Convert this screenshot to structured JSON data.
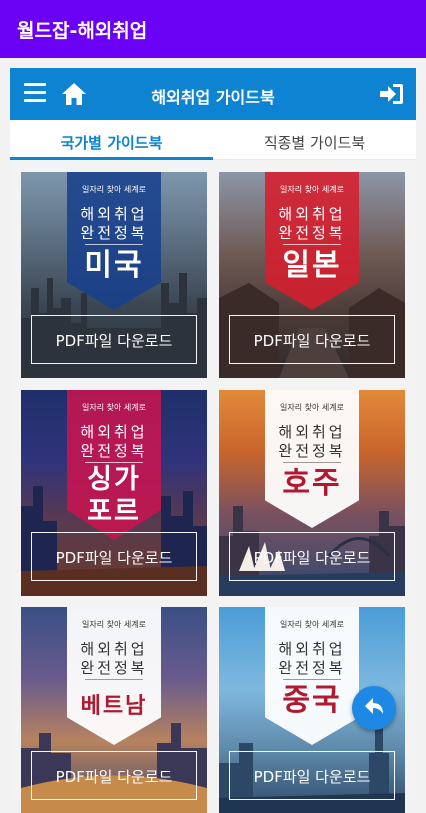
{
  "app": {
    "title": "월드잡-해외취업"
  },
  "topbar": {
    "title": "해외취업 가이드북",
    "icons": [
      "menu-icon",
      "home-icon",
      "login-icon"
    ]
  },
  "tabs": [
    {
      "label": "국가별 가이드북",
      "active": true
    },
    {
      "label": "직종별 가이드북",
      "active": false
    }
  ],
  "cards": [
    {
      "tagline": "일자리 찾아 세계로",
      "line1": "해외취업",
      "line2": "완전정복",
      "country": "미국",
      "download_label": "PDF파일 다운로드"
    },
    {
      "tagline": "일자리 찾아 세계로",
      "line1": "해외취업",
      "line2": "완전정복",
      "country": "일본",
      "download_label": "PDF파일 다운로드"
    },
    {
      "tagline": "일자리 찾아 세계로",
      "line1": "해외취업",
      "line2": "완전정복",
      "country_line1": "싱가",
      "country_line2": "포르",
      "download_label": "PDF파일 다운로드"
    },
    {
      "tagline": "일자리 찾아 세계로",
      "line1": "해외취업",
      "line2": "완전정복",
      "country": "호주",
      "download_label": "PDF파일 다운로드"
    },
    {
      "tagline": "일자리 찾아 세계로",
      "line1": "해외취업",
      "line2": "완전정복",
      "country": "베트남",
      "download_label": "PDF파일 다운로드"
    },
    {
      "tagline": "일자리 찾아 세계로",
      "line1": "해외취업",
      "line2": "완전정복",
      "country": "중국",
      "download_label": "PDF파일 다운로드"
    }
  ],
  "fab": {
    "icon": "back-arrow-icon"
  },
  "colors": {
    "appbar": "#6a00f4",
    "topbar": "#0d83d1",
    "fab": "#1e88e5"
  }
}
